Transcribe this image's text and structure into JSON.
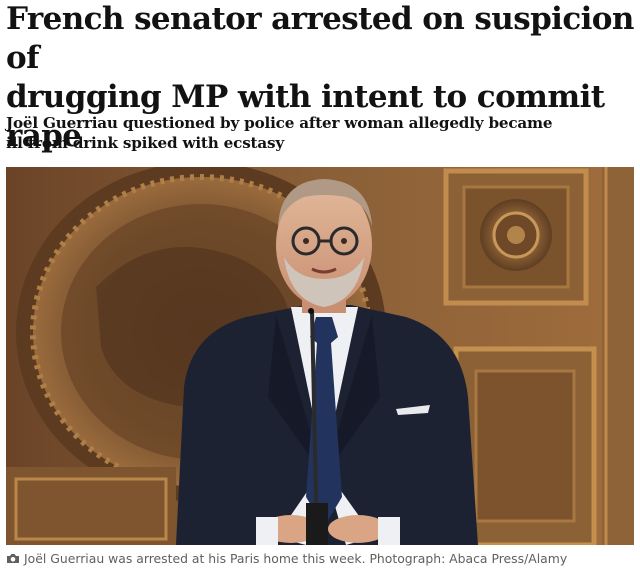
{
  "article": {
    "headline_line1": "French senator arrested on suspicion of",
    "headline_line2": "drugging MP with intent to commit rape",
    "standfirst_line1": "Joël Guerriau questioned by police after woman allegedly became",
    "standfirst_line2": "ill from drink spiked with ecstasy",
    "image": {
      "description_icon": "photo-of-man-at-podium",
      "caption": "Joël Guerriau was arrested at his Paris home this week. Photograph: Abaca Press/Alamy",
      "caption_icon": "camera-icon"
    }
  }
}
